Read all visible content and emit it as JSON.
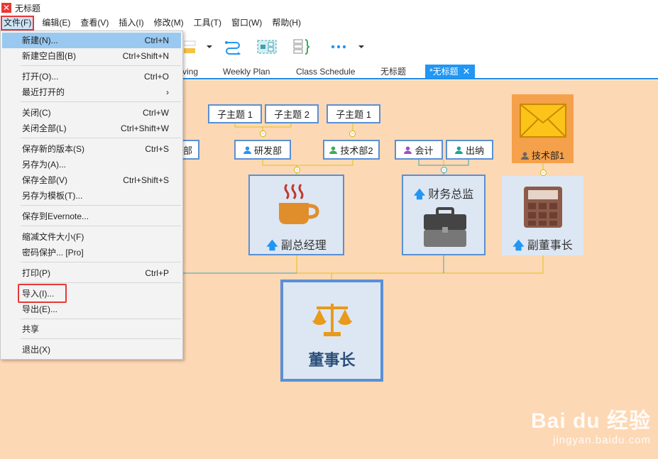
{
  "window": {
    "title": "无标题"
  },
  "menubar": [
    "文件(F)",
    "编辑(E)",
    "查看(V)",
    "插入(I)",
    "修改(M)",
    "工具(T)",
    "窗口(W)",
    "帮助(H)"
  ],
  "tabs": [
    "ving",
    "Weekly Plan",
    "Class Schedule",
    "无标题",
    "*无标题"
  ],
  "file_menu": {
    "items": [
      {
        "label": "新建(N)...",
        "shortcut": "Ctrl+N"
      },
      {
        "label": "新建空白图(B)",
        "shortcut": "Ctrl+Shift+N"
      },
      {
        "label": "打开(O)...",
        "shortcut": "Ctrl+O"
      },
      {
        "label": "最近打开的",
        "shortcut": "›"
      },
      {
        "label": "关闭(C)",
        "shortcut": "Ctrl+W"
      },
      {
        "label": "关闭全部(L)",
        "shortcut": "Ctrl+Shift+W"
      },
      {
        "label": "保存新的版本(S)",
        "shortcut": "Ctrl+S"
      },
      {
        "label": "另存为(A)...",
        "shortcut": ""
      },
      {
        "label": "保存全部(V)",
        "shortcut": "Ctrl+Shift+S"
      },
      {
        "label": "另存为模板(T)...",
        "shortcut": ""
      },
      {
        "label": "保存到Evernote...",
        "shortcut": ""
      },
      {
        "label": "缩减文件大小(F)",
        "shortcut": ""
      },
      {
        "label": "密码保护... [Pro]",
        "shortcut": ""
      },
      {
        "label": "打印(P)",
        "shortcut": "Ctrl+P"
      },
      {
        "label": "导入(I)...",
        "shortcut": ""
      },
      {
        "label": "导出(E)...",
        "shortcut": ""
      },
      {
        "label": "共享",
        "shortcut": ""
      },
      {
        "label": "退出(X)",
        "shortcut": ""
      }
    ]
  },
  "mindmap": {
    "subtopic_1a": "子主题 1",
    "subtopic_2": "子主题 2",
    "subtopic_1b": "子主题 1",
    "partial_dept": "部",
    "rd": "研发部",
    "tech2": "技术部2",
    "accountant": "会计",
    "cashier": "出纳",
    "tech1": "技术部1",
    "deputy_gm": "副总经理",
    "finance_director": "财务总监",
    "vice_chairman": "副董事长",
    "chairman": "董事长"
  },
  "watermark": {
    "brand": "Bai du 经验",
    "url": "jingyan.baidu.com"
  },
  "colors": {
    "canvas": "#fdd8b4",
    "accent": "#2196f3",
    "border": "#5b8fd4",
    "highlight": "#e53935"
  }
}
